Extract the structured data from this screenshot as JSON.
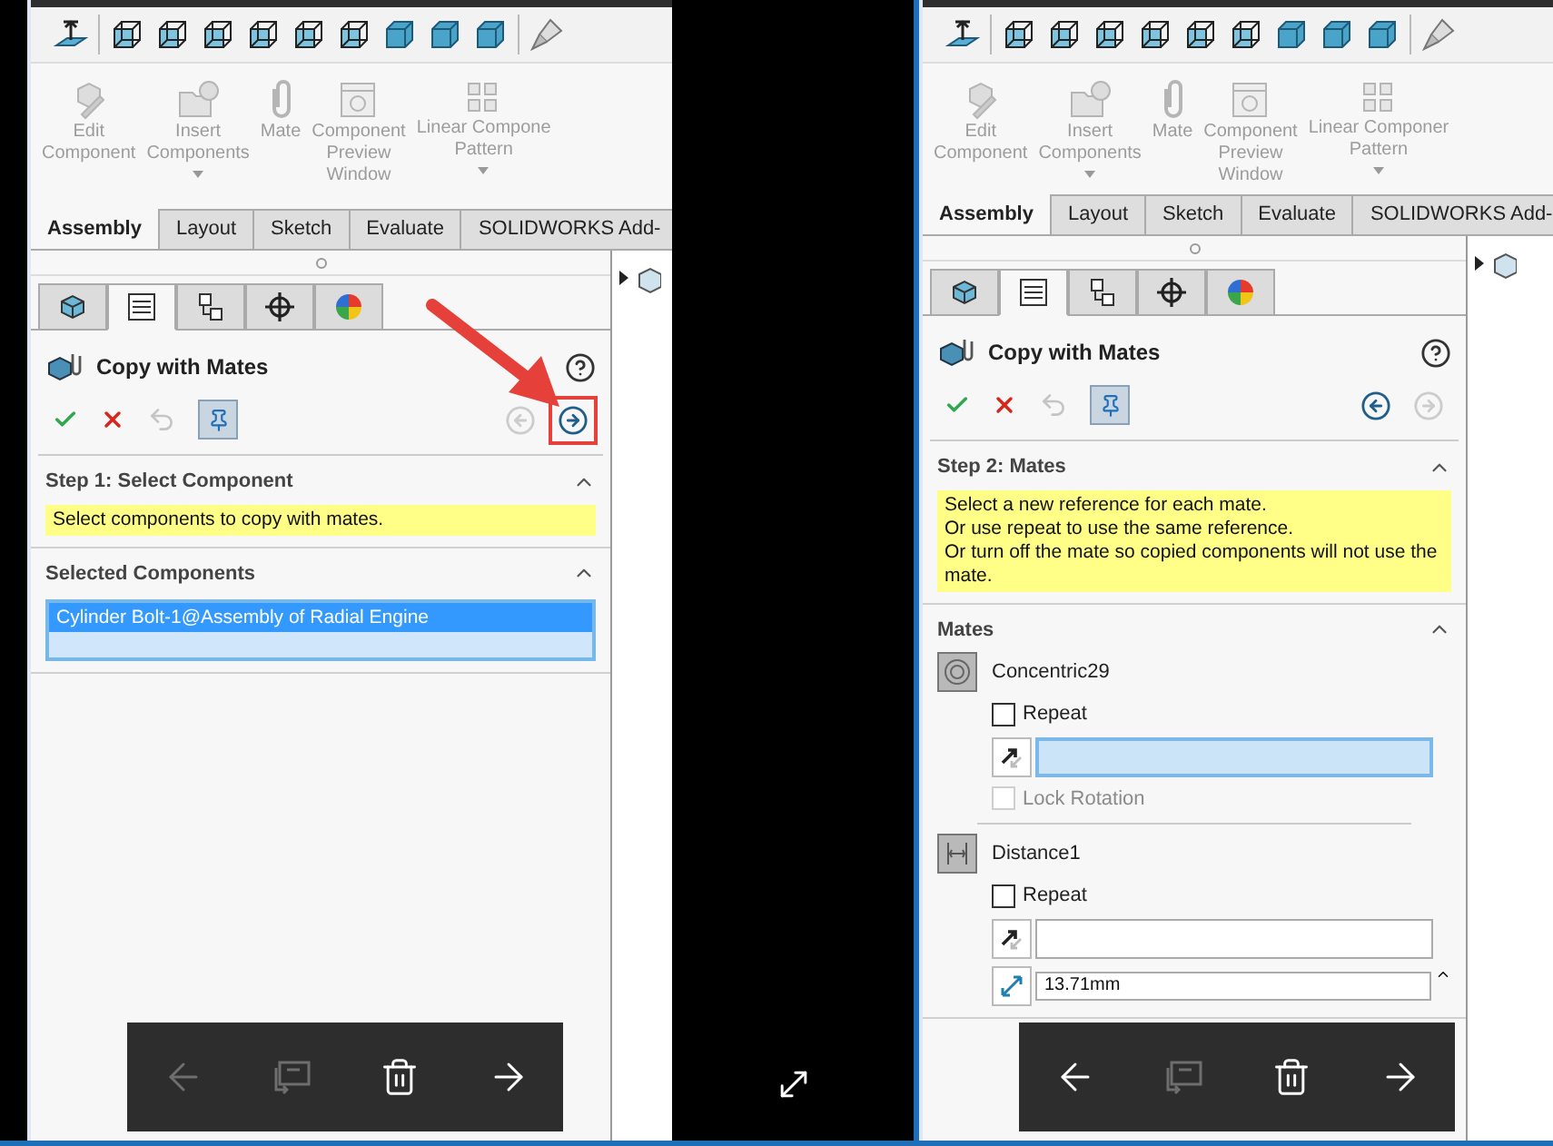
{
  "screens": [
    {
      "ribbon": [
        {
          "kind": "edit",
          "lines": [
            "Edit",
            "Component"
          ],
          "dropdown": false
        },
        {
          "kind": "insert",
          "lines": [
            "Insert",
            "Components"
          ],
          "dropdown": true
        },
        {
          "kind": "mate",
          "lines": [
            "Mate"
          ],
          "dropdown": false
        },
        {
          "kind": "preview",
          "lines": [
            "Component",
            "Preview",
            "Window"
          ],
          "dropdown": false
        },
        {
          "kind": "pattern",
          "lines": [
            "Linear Compone",
            "Pattern"
          ],
          "dropdown": true
        }
      ],
      "tabs": [
        {
          "label": "Assembly",
          "selected": true
        },
        {
          "label": "Layout",
          "selected": false
        },
        {
          "label": "Sketch",
          "selected": false
        },
        {
          "label": "Evaluate",
          "selected": false
        },
        {
          "label": "SOLIDWORKS Add-",
          "selected": false
        }
      ],
      "pm_tabs": [
        {
          "kind": "feature",
          "selected": false
        },
        {
          "kind": "property",
          "selected": true
        },
        {
          "kind": "config",
          "selected": false
        },
        {
          "kind": "dimxpert",
          "selected": false
        },
        {
          "kind": "display",
          "selected": false
        }
      ],
      "title": "Copy with Mates",
      "pin_active": true,
      "back_enabled": false,
      "forward_enabled": true,
      "forward_highlighted": true,
      "sections": [
        {
          "kind": "message",
          "title": "Step 1: Select Component",
          "expanded": true,
          "lines": [
            "Select components to copy with mates."
          ]
        },
        {
          "kind": "list",
          "title": "Selected Components",
          "expanded": true,
          "items": [
            {
              "text": "Cylinder Bolt-1@Assembly of Radial Engine",
              "selected": true
            }
          ]
        }
      ],
      "viewer_toolbar": {
        "back_enabled": false
      }
    },
    {
      "ribbon": [
        {
          "kind": "edit",
          "lines": [
            "Edit",
            "Component"
          ],
          "dropdown": false
        },
        {
          "kind": "insert",
          "lines": [
            "Insert",
            "Components"
          ],
          "dropdown": true
        },
        {
          "kind": "mate",
          "lines": [
            "Mate"
          ],
          "dropdown": false
        },
        {
          "kind": "preview",
          "lines": [
            "Component",
            "Preview",
            "Window"
          ],
          "dropdown": false
        },
        {
          "kind": "pattern",
          "lines": [
            "Linear Componer",
            "Pattern"
          ],
          "dropdown": true
        }
      ],
      "tabs": [
        {
          "label": "Assembly",
          "selected": true
        },
        {
          "label": "Layout",
          "selected": false
        },
        {
          "label": "Sketch",
          "selected": false
        },
        {
          "label": "Evaluate",
          "selected": false
        },
        {
          "label": "SOLIDWORKS Add-",
          "selected": false
        }
      ],
      "pm_tabs": [
        {
          "kind": "feature",
          "selected": false
        },
        {
          "kind": "property",
          "selected": true
        },
        {
          "kind": "config",
          "selected": false
        },
        {
          "kind": "dimxpert",
          "selected": false
        },
        {
          "kind": "display",
          "selected": false
        }
      ],
      "title": "Copy with Mates",
      "pin_active": true,
      "back_enabled": true,
      "forward_enabled": false,
      "forward_highlighted": false,
      "sections": [
        {
          "kind": "message",
          "title": "Step 2: Mates",
          "expanded": true,
          "lines": [
            "Select a new reference for each mate.",
            "Or use repeat to use the same reference.",
            "Or turn off the mate so copied components will not use the mate."
          ]
        },
        {
          "kind": "mates",
          "title": "Mates",
          "expanded": true,
          "mates": [
            {
              "kind": "concentric",
              "name": "Concentric29",
              "repeat_label": "Repeat",
              "repeat": false,
              "reference_active": true,
              "lock_label": "Lock Rotation",
              "lock_rotation": false,
              "lock_disabled": true
            },
            {
              "kind": "distance",
              "name": "Distance1",
              "repeat_label": "Repeat",
              "repeat": false,
              "reference_active": false,
              "distance": "13.71mm"
            }
          ]
        }
      ],
      "viewer_toolbar": {
        "back_enabled": true
      }
    }
  ]
}
